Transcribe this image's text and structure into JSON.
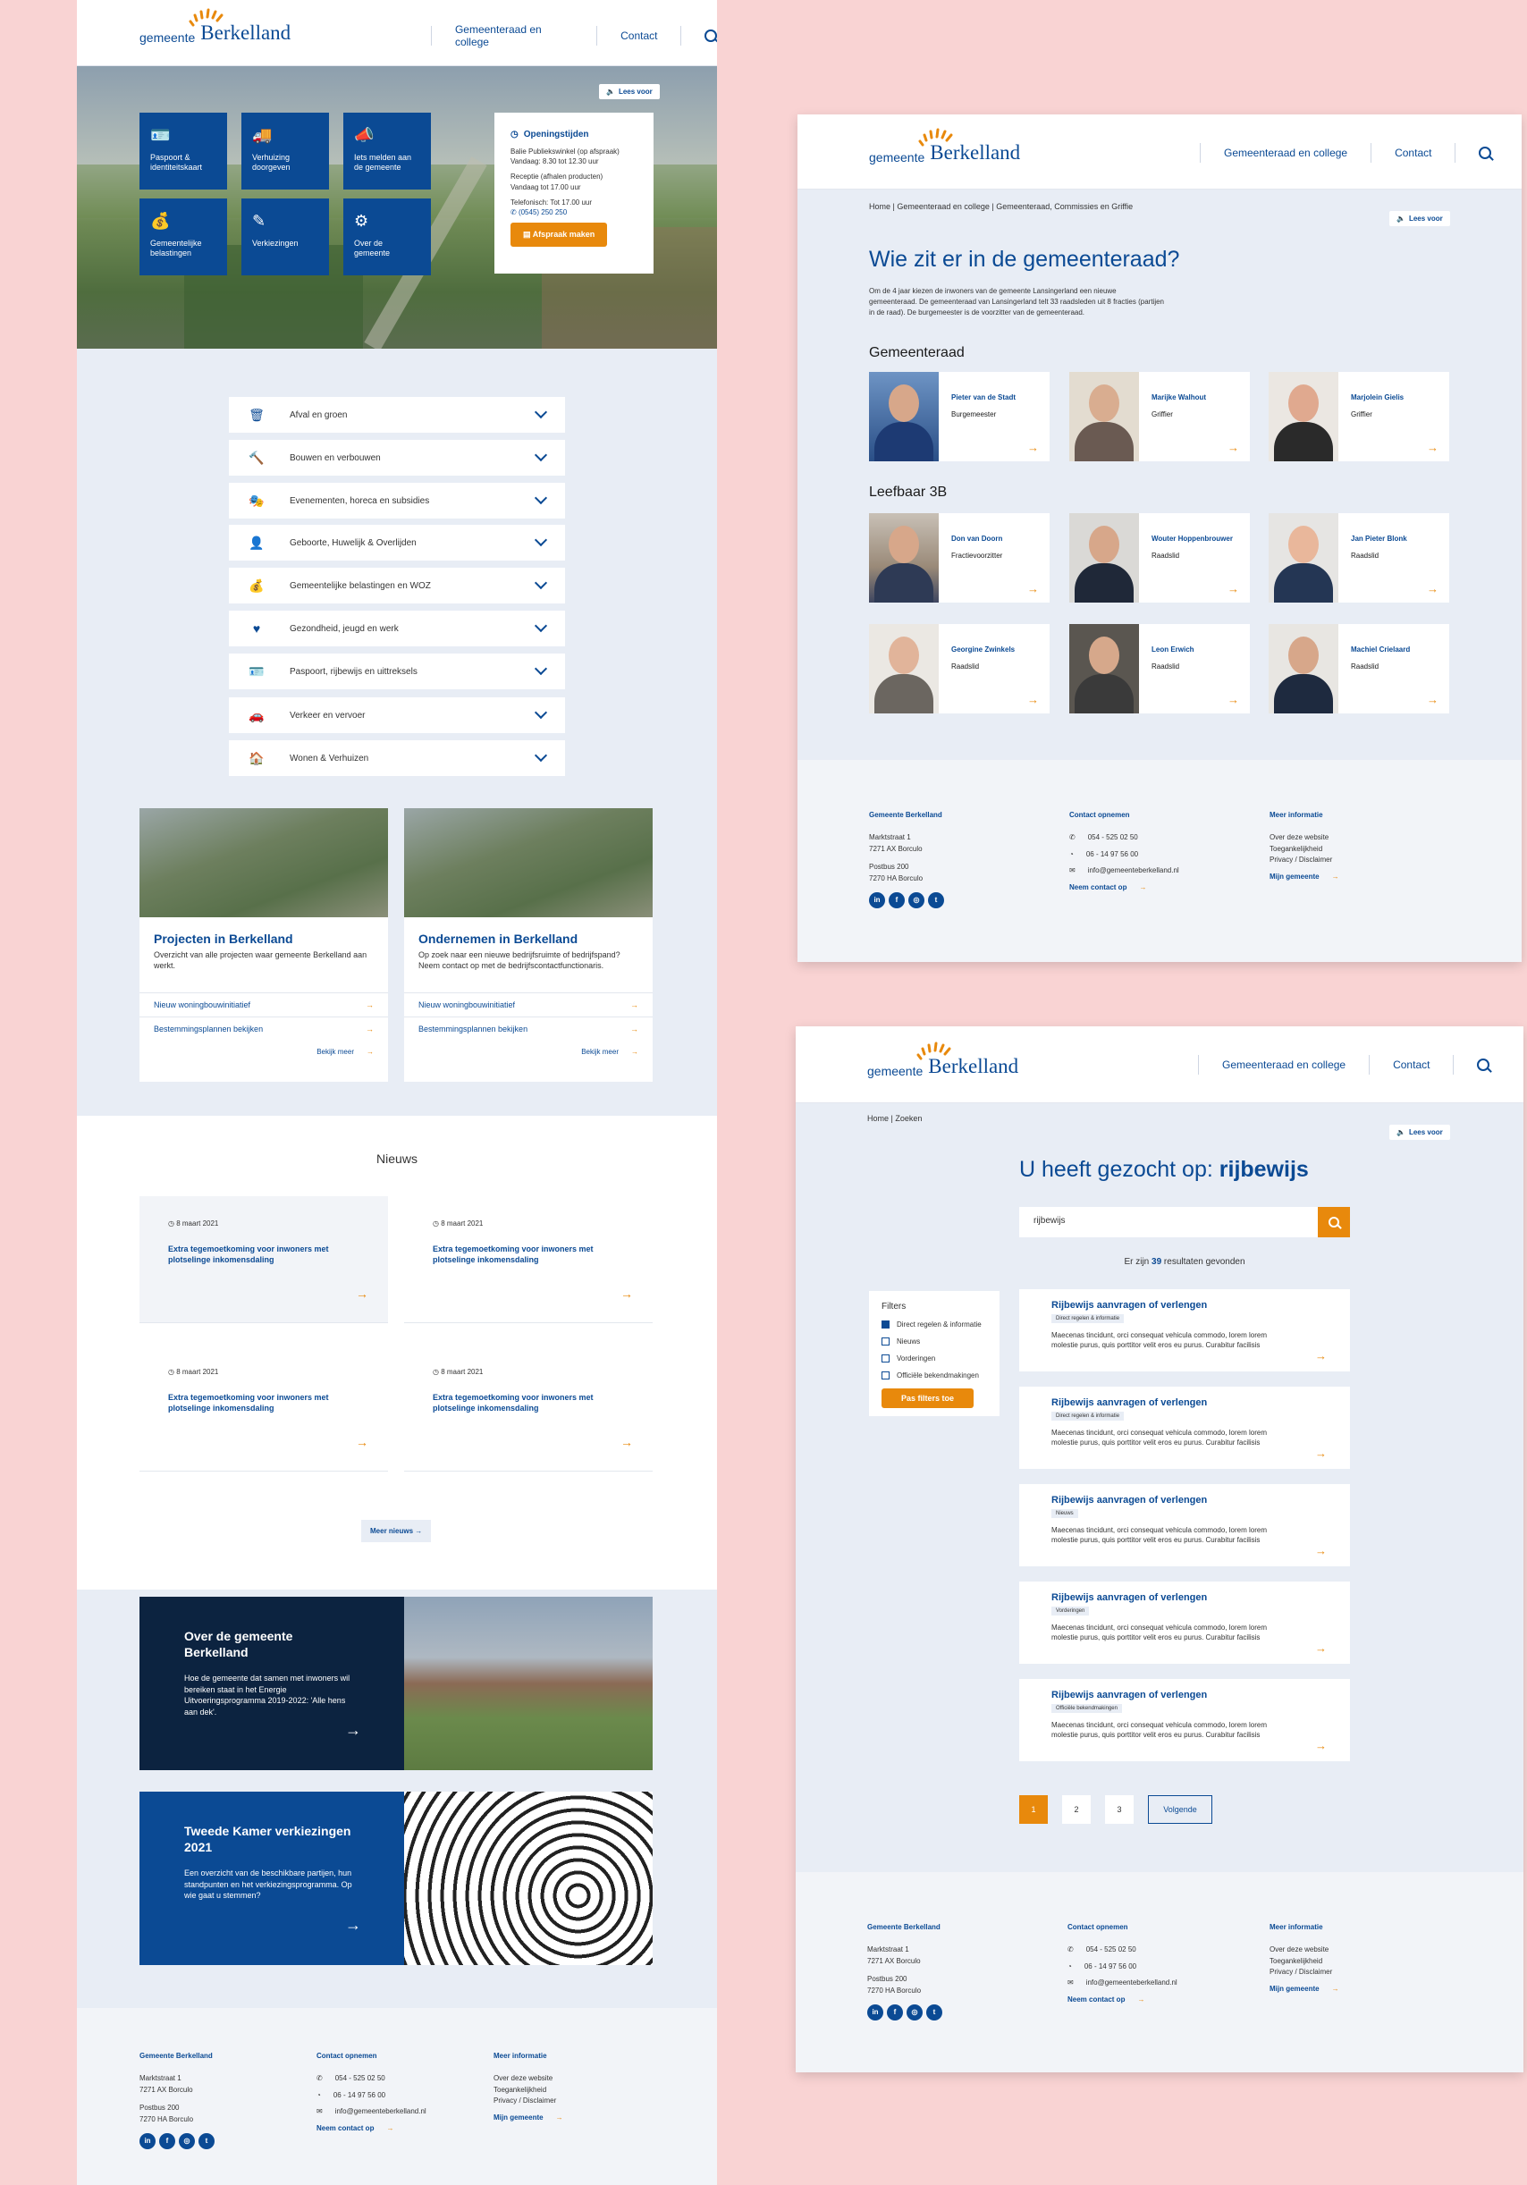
{
  "logo": {
    "gemeente": "gemeente",
    "name": "Berkelland"
  },
  "nav": {
    "college": "Gemeenteraad en college",
    "contact": "Contact"
  },
  "leesvoor": "Lees voor",
  "home": {
    "tiles": [
      {
        "icon": "id-card-icon",
        "glyph": "🪪",
        "label": "Paspoort & identiteitskaart"
      },
      {
        "icon": "truck-icon",
        "glyph": "🚚",
        "label": "Verhuizing doorgeven"
      },
      {
        "icon": "megaphone-icon",
        "glyph": "📣",
        "label": "Iets melden aan de gemeente"
      },
      {
        "icon": "coin-icon",
        "glyph": "💰",
        "label": "Gemeentelijke belastingen"
      },
      {
        "icon": "edit-icon",
        "glyph": "✎",
        "label": "Verkiezingen"
      },
      {
        "icon": "gear-icon",
        "glyph": "⚙",
        "label": "Over de gemeente"
      }
    ],
    "opening": {
      "title": "Openingstijden",
      "line1": "Balie Publiekswinkel (op afspraak)",
      "line2": "Vandaag: 8.30 tot 12.30 uur",
      "line3": "Receptie (afhalen producten)",
      "line4": "Vandaag tot 17.00 uur",
      "line5": "Telefonisch: Tot 17.00 uur",
      "phone": "(0545) 250 250",
      "button": "Afspraak maken"
    },
    "accordion": [
      {
        "icon": "trash-icon",
        "glyph": "🗑",
        "label": "Afval en groen"
      },
      {
        "icon": "hammer-icon",
        "glyph": "🔨",
        "label": "Bouwen en verbouwen"
      },
      {
        "icon": "events-icon",
        "glyph": "🎭",
        "label": "Evenementen, horeca en subsidies"
      },
      {
        "icon": "person-icon",
        "glyph": "👤",
        "label": "Geboorte, Huwelijk & Overlijden"
      },
      {
        "icon": "coin-icon",
        "glyph": "💰",
        "label": "Gemeentelijke belastingen en WOZ"
      },
      {
        "icon": "heart-icon",
        "glyph": "♥",
        "label": "Gezondheid, jeugd en werk"
      },
      {
        "icon": "id-card-icon",
        "glyph": "🪪",
        "label": "Paspoort, rijbewijs en uittreksels"
      },
      {
        "icon": "car-icon",
        "glyph": "🚗",
        "label": "Verkeer en vervoer"
      },
      {
        "icon": "house-icon",
        "glyph": "🏠",
        "label": "Wonen & Verhuizen"
      }
    ],
    "cards": [
      {
        "title": "Projecten in Berkelland",
        "desc": "Overzicht van alle projecten waar gemeente Berkelland aan werkt.",
        "link1": "Nieuw woningbouwinitiatief",
        "link2": "Bestemmingsplannen bekijken",
        "more": "Bekijk meer"
      },
      {
        "title": "Ondernemen in Berkelland",
        "desc": "Op zoek naar een nieuwe bedrijfsruimte of bedrijfspand? Neem contact op met de bedrijfscontactfunctionaris.",
        "link1": "Nieuw woningbouwinitiatief",
        "link2": "Bestemmingsplannen bekijken",
        "more": "Bekijk meer"
      }
    ],
    "news_title": "Nieuws",
    "news": [
      {
        "date": "8 maart 2021",
        "title": "Extra tegemoetkoming voor inwoners met plotselinge inkomensdaling"
      },
      {
        "date": "8 maart 2021",
        "title": "Extra tegemoetkoming voor inwoners met plotselinge inkomensdaling"
      },
      {
        "date": "8 maart 2021",
        "title": "Extra tegemoetkoming voor inwoners met plotselinge inkomensdaling"
      },
      {
        "date": "8 maart 2021",
        "title": "Extra tegemoetkoming voor inwoners met plotselinge inkomensdaling"
      }
    ],
    "more_news": "Meer nieuws",
    "promo1": {
      "title": "Over de gemeente Berkelland",
      "text": "Hoe de gemeente dat samen met inwoners wil bereiken staat in het Energie Uitvoeringsprogramma 2019-2022: 'Alle hens aan dek'."
    },
    "promo2": {
      "title": "Tweede Kamer verkiezingen 2021",
      "text": "Een overzicht van de beschikbare partijen, hun standpunten en het verkiezingsprogramma. Op wie gaat u stemmen?"
    }
  },
  "footer": {
    "col1_title": "Gemeente Berkelland",
    "addr1": "Marktstraat 1",
    "addr2": "7271 AX Borculo",
    "addr3": "Postbus 200",
    "addr4": "7270 HA Borculo",
    "col2_title": "Contact opnemen",
    "phone": "054 - 525 02 50",
    "whatsapp": "06 - 14 97 56 00",
    "email": "info@gemeenteberkelland.nl",
    "contact_link": "Neem contact op",
    "col3_title": "Meer informatie",
    "info1": "Over deze website",
    "info2": "Toegankelijkheid",
    "info3": "Privacy / Disclaimer",
    "info_link": "Mijn gemeente"
  },
  "raad": {
    "breadcrumb": "Home | Gemeenteraad en college | Gemeenteraad, Commissies en Griffie",
    "title": "Wie zit er in de gemeenteraad?",
    "intro": "Om de 4 jaar kiezen de inwoners van de gemeente Lansingerland een nieuwe gemeenteraad. De gemeenteraad van Lansingerland telt 33 raadsleden uit 8 fracties (partijen in de raad). De burgemeester is de voorzitter van de gemeenteraad.",
    "section1": "Gemeenteraad",
    "members1": [
      {
        "name": "Pieter van de Stadt",
        "role": "Burgemeester"
      },
      {
        "name": "Marijke Walhout",
        "role": "Griffier"
      },
      {
        "name": "Marjolein Gielis",
        "role": "Griffier"
      }
    ],
    "section2": "Leefbaar 3B",
    "members2": [
      {
        "name": "Don van Doorn",
        "role": "Fractievoorzitter"
      },
      {
        "name": "Wouter Hoppenbrouwer",
        "role": "Raadslid"
      },
      {
        "name": "Jan Pieter Blonk",
        "role": "Raadslid"
      },
      {
        "name": "Georgine Zwinkels",
        "role": "Raadslid"
      },
      {
        "name": "Leon Erwich",
        "role": "Raadslid"
      },
      {
        "name": "Machiel Crielaard",
        "role": "Raadslid"
      }
    ]
  },
  "zoek": {
    "breadcrumb": "Home | Zoeken",
    "title_prefix": "U heeft gezocht op:",
    "title_term": "rijbewijs",
    "query": "rijbewijs",
    "count_pre": "Er zijn",
    "count": "39",
    "count_post": "resultaten gevonden",
    "filters_title": "Filters",
    "filters": [
      {
        "label": "Direct regelen & informatie",
        "checked": true
      },
      {
        "label": "Nieuws",
        "checked": false
      },
      {
        "label": "Vorderingen",
        "checked": false
      },
      {
        "label": "Officiële bekendmakingen",
        "checked": false
      }
    ],
    "apply": "Pas filters toe",
    "results": [
      {
        "title": "Rijbewijs aanvragen of verlengen",
        "tag": "Direct regelen & informatie",
        "desc": "Maecenas tincidunt, orci consequat vehicula commodo, lorem lorem molestie purus, quis porttitor velit eros eu purus. Curabitur facilisis"
      },
      {
        "title": "Rijbewijs aanvragen of verlengen",
        "tag": "Direct regelen & informatie",
        "desc": "Maecenas tincidunt, orci consequat vehicula commodo, lorem lorem molestie purus, quis porttitor velit eros eu purus. Curabitur facilisis"
      },
      {
        "title": "Rijbewijs aanvragen of verlengen",
        "tag": "Nieuws",
        "desc": "Maecenas tincidunt, orci consequat vehicula commodo, lorem lorem molestie purus, quis porttitor velit eros eu purus. Curabitur facilisis"
      },
      {
        "title": "Rijbewijs aanvragen of verlengen",
        "tag": "Vorderingen",
        "desc": "Maecenas tincidunt, orci consequat vehicula commodo, lorem lorem molestie purus, quis porttitor velit eros eu purus. Curabitur facilisis"
      },
      {
        "title": "Rijbewijs aanvragen of verlengen",
        "tag": "Officiële bekendmakingen",
        "desc": "Maecenas tincidunt, orci consequat vehicula commodo, lorem lorem molestie purus, quis porttitor velit eros eu purus. Curabitur facilisis"
      }
    ],
    "pages": [
      "1",
      "2",
      "3"
    ],
    "next": "Volgende"
  },
  "colors": {
    "brand": "#0b4a94",
    "accent": "#e8890c",
    "bg": "#e8edf5",
    "dark": "#0c2340"
  }
}
